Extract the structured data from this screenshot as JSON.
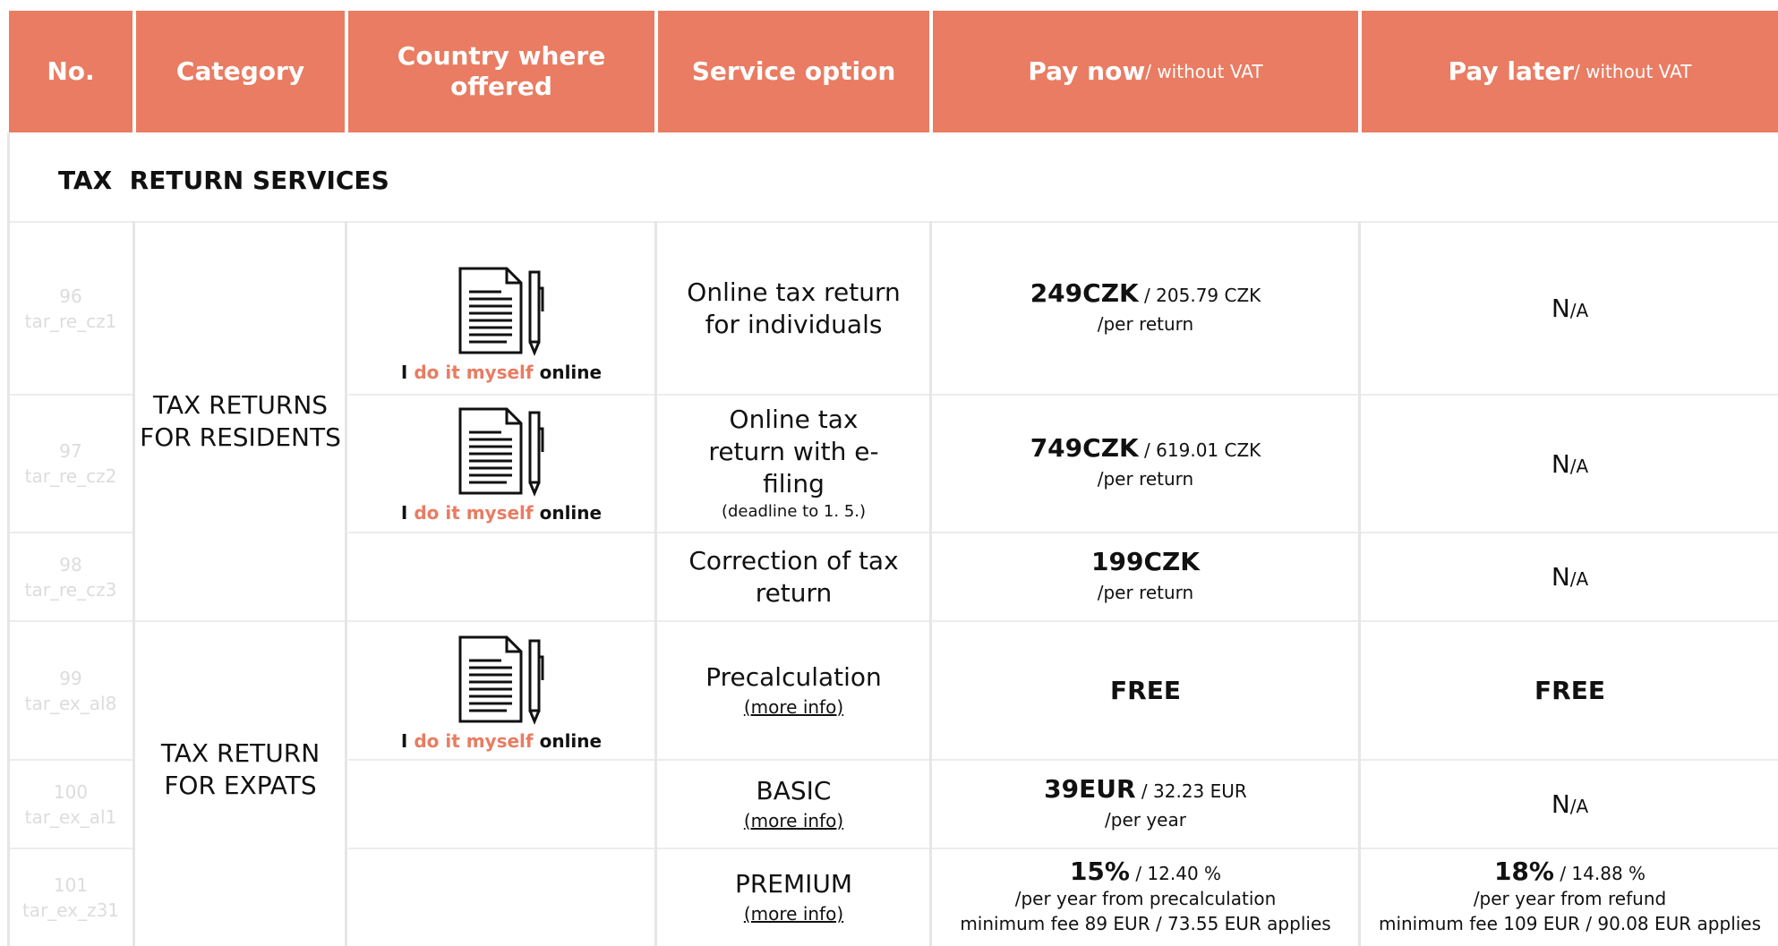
{
  "header": {
    "no": "No.",
    "category": "Category",
    "country": "Country where offered",
    "service": "Service option",
    "pay_now": "Pay now",
    "pay_now_sub": " / without VAT",
    "pay_later": "Pay later",
    "pay_later_sub": " / without VAT"
  },
  "section_title": "TAX  RETURN SERVICES",
  "categories": {
    "residents": "TAX RETURNS FOR RESIDENTS",
    "expats": "TAX RETURN FOR EXPATS"
  },
  "offer_label": {
    "pre": "I ",
    "hl": "do it myself",
    "post": " online"
  },
  "rows": [
    {
      "no": "96",
      "code": "tar_re_cz1",
      "service": "Online tax return for individuals",
      "note": "",
      "more": "",
      "now_main": "249CZK",
      "now_sub": " / 205.79 CZK",
      "now_line2": "/per return",
      "now_line3": "",
      "later": "N/A"
    },
    {
      "no": "97",
      "code": "tar_re_cz2",
      "service": "Online tax return with e-filing",
      "note": "(deadline to 1. 5.)",
      "more": "",
      "now_main": "749CZK",
      "now_sub": " / 619.01 CZK",
      "now_line2": "/per return",
      "now_line3": "",
      "later": "N/A"
    },
    {
      "no": "98",
      "code": "tar_re_cz3",
      "service": "Correction of tax return",
      "note": "",
      "more": "",
      "now_main": "199CZK",
      "now_sub": "",
      "now_line2": "/per return",
      "now_line3": "",
      "later": "N/A"
    },
    {
      "no": "99",
      "code": "tar_ex_al8",
      "service": "Precalculation",
      "note": "",
      "more": "(more info)",
      "now_main": "FREE",
      "later": "FREE"
    },
    {
      "no": "100",
      "code": "tar_ex_al1",
      "service": "BASIC",
      "note": "",
      "more": "(more info)",
      "now_main": "39EUR",
      "now_sub": " / 32.23 EUR",
      "now_line2": "/per year",
      "now_line3": "",
      "later": "N/A"
    },
    {
      "no": "101",
      "code": "tar_ex_z31",
      "service": "PREMIUM",
      "note": "",
      "more": "(more info)",
      "now_main": "15%",
      "now_sub": " / 12.40 %",
      "now_line2": "/per year from precalculation",
      "now_line3": "minimum fee 89 EUR / 73.55 EUR applies",
      "later_main": "18%",
      "later_sub": " / 14.88 %",
      "later_line2": "/per year from refund",
      "later_line3": "minimum fee 109 EUR / 90.08 EUR applies"
    }
  ],
  "accent_color": "#E97C62"
}
